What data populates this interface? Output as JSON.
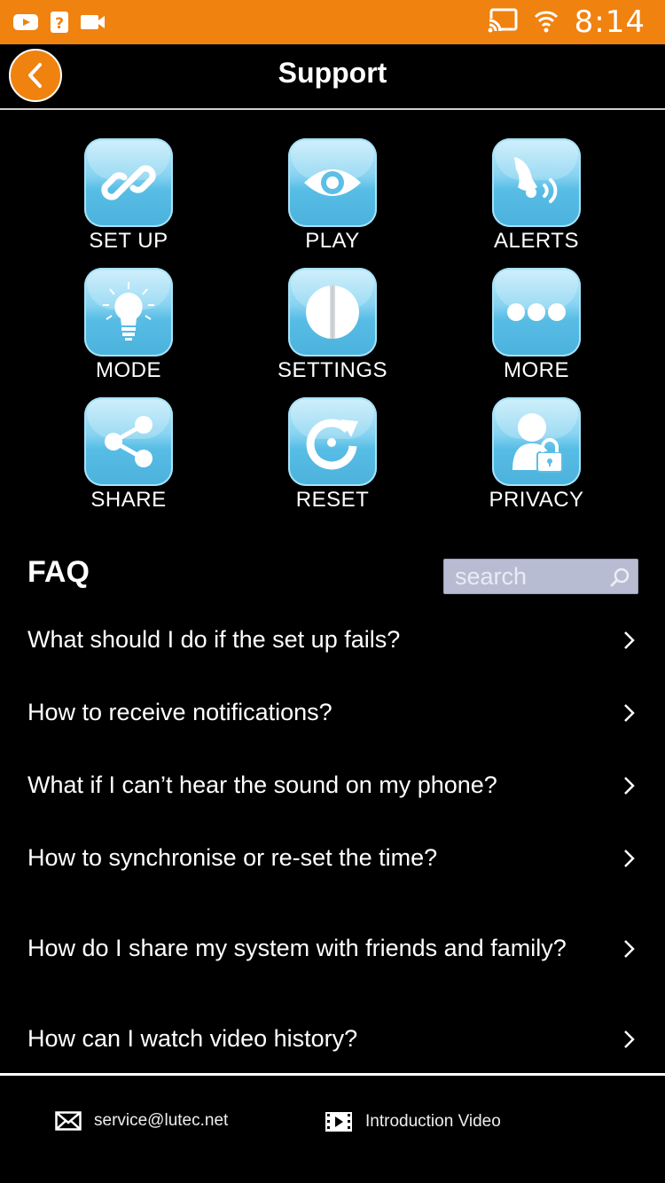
{
  "status_bar": {
    "time": "8:14",
    "left_icons": [
      "youtube-icon",
      "help-icon",
      "video-icon"
    ],
    "right_icons": [
      "cast-icon",
      "wifi-icon"
    ],
    "background": "#f0820f"
  },
  "header": {
    "title": "Support",
    "back_icon": "chevron-left-icon"
  },
  "tiles": [
    {
      "label": "SET UP",
      "icon": "link-icon"
    },
    {
      "label": "PLAY",
      "icon": "eye-icon"
    },
    {
      "label": "ALERTS",
      "icon": "bell-icon"
    },
    {
      "label": "MODE",
      "icon": "lightbulb-icon"
    },
    {
      "label": "SETTINGS",
      "icon": "settings-icon"
    },
    {
      "label": "MORE",
      "icon": "more-icon"
    },
    {
      "label": "SHARE",
      "icon": "share-icon"
    },
    {
      "label": "RESET",
      "icon": "reset-icon"
    },
    {
      "label": "PRIVACY",
      "icon": "privacy-lock-icon"
    }
  ],
  "faq": {
    "title": "FAQ",
    "search_placeholder": "search",
    "items": [
      {
        "question": "What should I do if the set up fails?"
      },
      {
        "question": "How to receive notifications?"
      },
      {
        "question": "What if I can’t hear the sound on my phone?"
      },
      {
        "question": "How to synchronise or re-set the time?"
      },
      {
        "question": "How do I share my system with friends and family?"
      },
      {
        "question": "How can I watch video history?"
      }
    ]
  },
  "footer": {
    "email": "service@lutec.net",
    "video_label": "Introduction Video"
  },
  "colors": {
    "accent": "#f0820f",
    "tile_blue": "#58bde5",
    "background": "#000000"
  }
}
